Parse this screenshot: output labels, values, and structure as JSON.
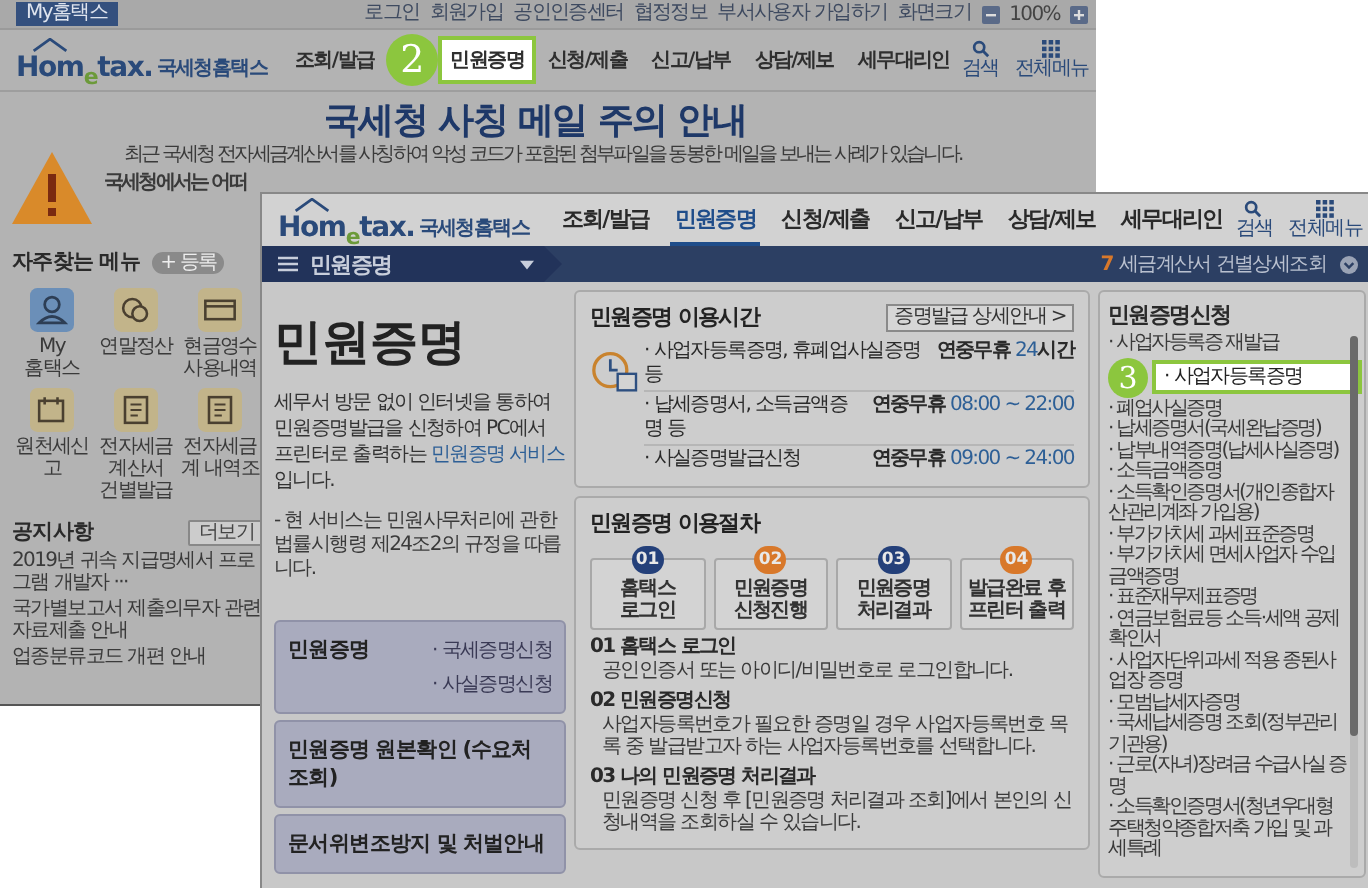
{
  "back_page": {
    "top_tab": "My홈택스",
    "top_links": [
      "로그인",
      "회원가입",
      "공인인증센터",
      "협정정보",
      "부서사용자 가입하기",
      "화면크기"
    ],
    "zoom_value": "100%",
    "logo": {
      "brand": "Hom$_{e}$tax.",
      "name": "국세청홈택스"
    },
    "nav": [
      {
        "label": "조회/발급",
        "selected": false
      },
      {
        "label": "민원증명",
        "selected": true,
        "callout": "2"
      },
      {
        "label": "신청/제출",
        "selected": false
      },
      {
        "label": "신고/납부",
        "selected": false
      },
      {
        "label": "상담/제보",
        "selected": false
      },
      {
        "label": "세무대리인",
        "selected": false
      }
    ],
    "tools": [
      "검색",
      "전체메뉴"
    ],
    "banner": {
      "title": "국세청 사칭 메일 주의 안내",
      "line_1": "최근 국세청 전자세금계산서를 사칭하여 악성 코드가 포함된 첨부파일을 동봉한 메일을 보내는 사례가 있습니다.",
      "line_2": "국세청에서는 어떠"
    },
    "quick_menu": {
      "title": "자주찾는 메뉴",
      "add_button": "+ 등록",
      "items": [
        {
          "kind": "person",
          "label": "My 홈택스"
        },
        {
          "kind": "coins",
          "label": "연말정산"
        },
        {
          "kind": "card",
          "label": "현금영수 사용내역"
        },
        {
          "kind": "calendar",
          "label": "원천세신고"
        },
        {
          "kind": "document",
          "label": "전자세금계산서 건별발급"
        },
        {
          "kind": "document",
          "label": "전자세금계 내역조"
        }
      ]
    },
    "notices": {
      "title": "공지사항",
      "more": "더보기",
      "items": [
        "2019년 귀속 지급명세서 프로그램 개발자 ···",
        "국가별보고서 제출의무자 관련 자료제출 안내",
        "업종분류코드 개편 안내"
      ]
    }
  },
  "front_page": {
    "logo": {
      "brand": "Hom$_{e}$tax.",
      "name": "국세청홈택스"
    },
    "nav": [
      {
        "label": "조회/발급",
        "selected": false
      },
      {
        "label": "민원증명",
        "selected": true
      },
      {
        "label": "신청/제출",
        "selected": false
      },
      {
        "label": "신고/납부",
        "selected": false
      },
      {
        "label": "상담/제보",
        "selected": false
      },
      {
        "label": "세무대리인",
        "selected": false
      }
    ],
    "tools": [
      "검색",
      "전체메뉴"
    ],
    "menu_bar": {
      "title": "민원증명",
      "recent_count": "7",
      "recent_label": "세금계산서 건별상세조회"
    },
    "intro": {
      "title": "민원증명",
      "before": "세무서 방문 없이 인터넷을 통하여 민원증명발급을 신청하여 PC에서 프린터로 출력하는 ",
      "link": "민원증명 서비스",
      "after": "입니다.",
      "note": "- 현 서비스는 민원사무처리에 관한 법률시행령 제24조2의 규정을 따릅니다."
    },
    "menu_cards": [
      {
        "title": "민원증명",
        "links": [
          "· 국세증명신청",
          "· 사실증명신청"
        ]
      },
      {
        "title": "민원증명 원본확인 (수요처 조회)"
      },
      {
        "title": "문서위변조방지 및 처벌안내"
      }
    ],
    "hours": {
      "title": "민원증명 이용시간",
      "button": "증명발급 상세안내 >",
      "rows": [
        {
          "item": "· 사업자등록증명, 휴폐업사실증명 등",
          "days": "연중무휴",
          "time": "24",
          "suffix": "시간"
        },
        {
          "item": "· 납세증명서, 소득금액증명 등",
          "days": "연중무휴",
          "time": "08:00 ~ 22:00"
        },
        {
          "item": "· 사실증명발급신청",
          "days": "연중무휴",
          "time": "09:00 ~ 24:00"
        }
      ]
    },
    "procedure": {
      "title": "민원증명 이용절차",
      "steps": [
        {
          "number": "01",
          "label": "홈택스 로그인",
          "color": "#24407a"
        },
        {
          "number": "02",
          "label": "민원증명 신청진행",
          "color": "#d8782a"
        },
        {
          "number": "03",
          "label": "민원증명 처리결과",
          "color": "#24407a"
        },
        {
          "number": "04",
          "label": "발급완료 후 프린터 출력",
          "color": "#d8782a"
        }
      ],
      "sections": [
        {
          "heading": "01 홈택스 로그인",
          "text": "공인인증서 또는 아이디/비밀번호로 로그인합니다."
        },
        {
          "heading": "02 민원증명신청",
          "text": "사업자등록번호가 필요한 증명일 경우 사업자등록번호 목록 중 발급받고자 하는 사업자등록번호를 선택합니다."
        },
        {
          "heading": "03 나의 민원증명 처리결과",
          "text": "민원증명 신청 후 [민원증명 처리결과 조회]에서 본인의 신청내역을 조회하실 수 있습니다."
        }
      ]
    },
    "sidebar": {
      "title": "민원증명신청",
      "items": [
        {
          "label": "· 사업자등록증 재발급"
        },
        {
          "label": "· 사업자등록증명",
          "callout": "3"
        },
        {
          "label": "· 폐업사실증명"
        },
        {
          "label": "· 납세증명서(국세완납증명)"
        },
        {
          "label": "· 납부내역증명(납세사실증명)"
        },
        {
          "label": "· 소득금액증명"
        },
        {
          "label": "· 소득확인증명서(개인종합자산관리계좌 가입용)"
        },
        {
          "label": "· 부가가치세 과세표준증명"
        },
        {
          "label": "· 부가가치세 면세사업자 수입금액증명"
        },
        {
          "label": "· 표준재무제표증명"
        },
        {
          "label": "· 연금보험료등 소득·세액 공제확인서"
        },
        {
          "label": "· 사업자단위과세 적용 종된사업장 증명"
        },
        {
          "label": "· 모범납세자증명"
        },
        {
          "label": "· 국세납세증명 조회(정부관리기관용)"
        },
        {
          "label": "· 근로(자녀)장려금 수급사실 증명"
        },
        {
          "label": "· 소득확인증명서(청년우대형주택청약종합저축 가입 및 과세특례"
        }
      ]
    }
  }
}
